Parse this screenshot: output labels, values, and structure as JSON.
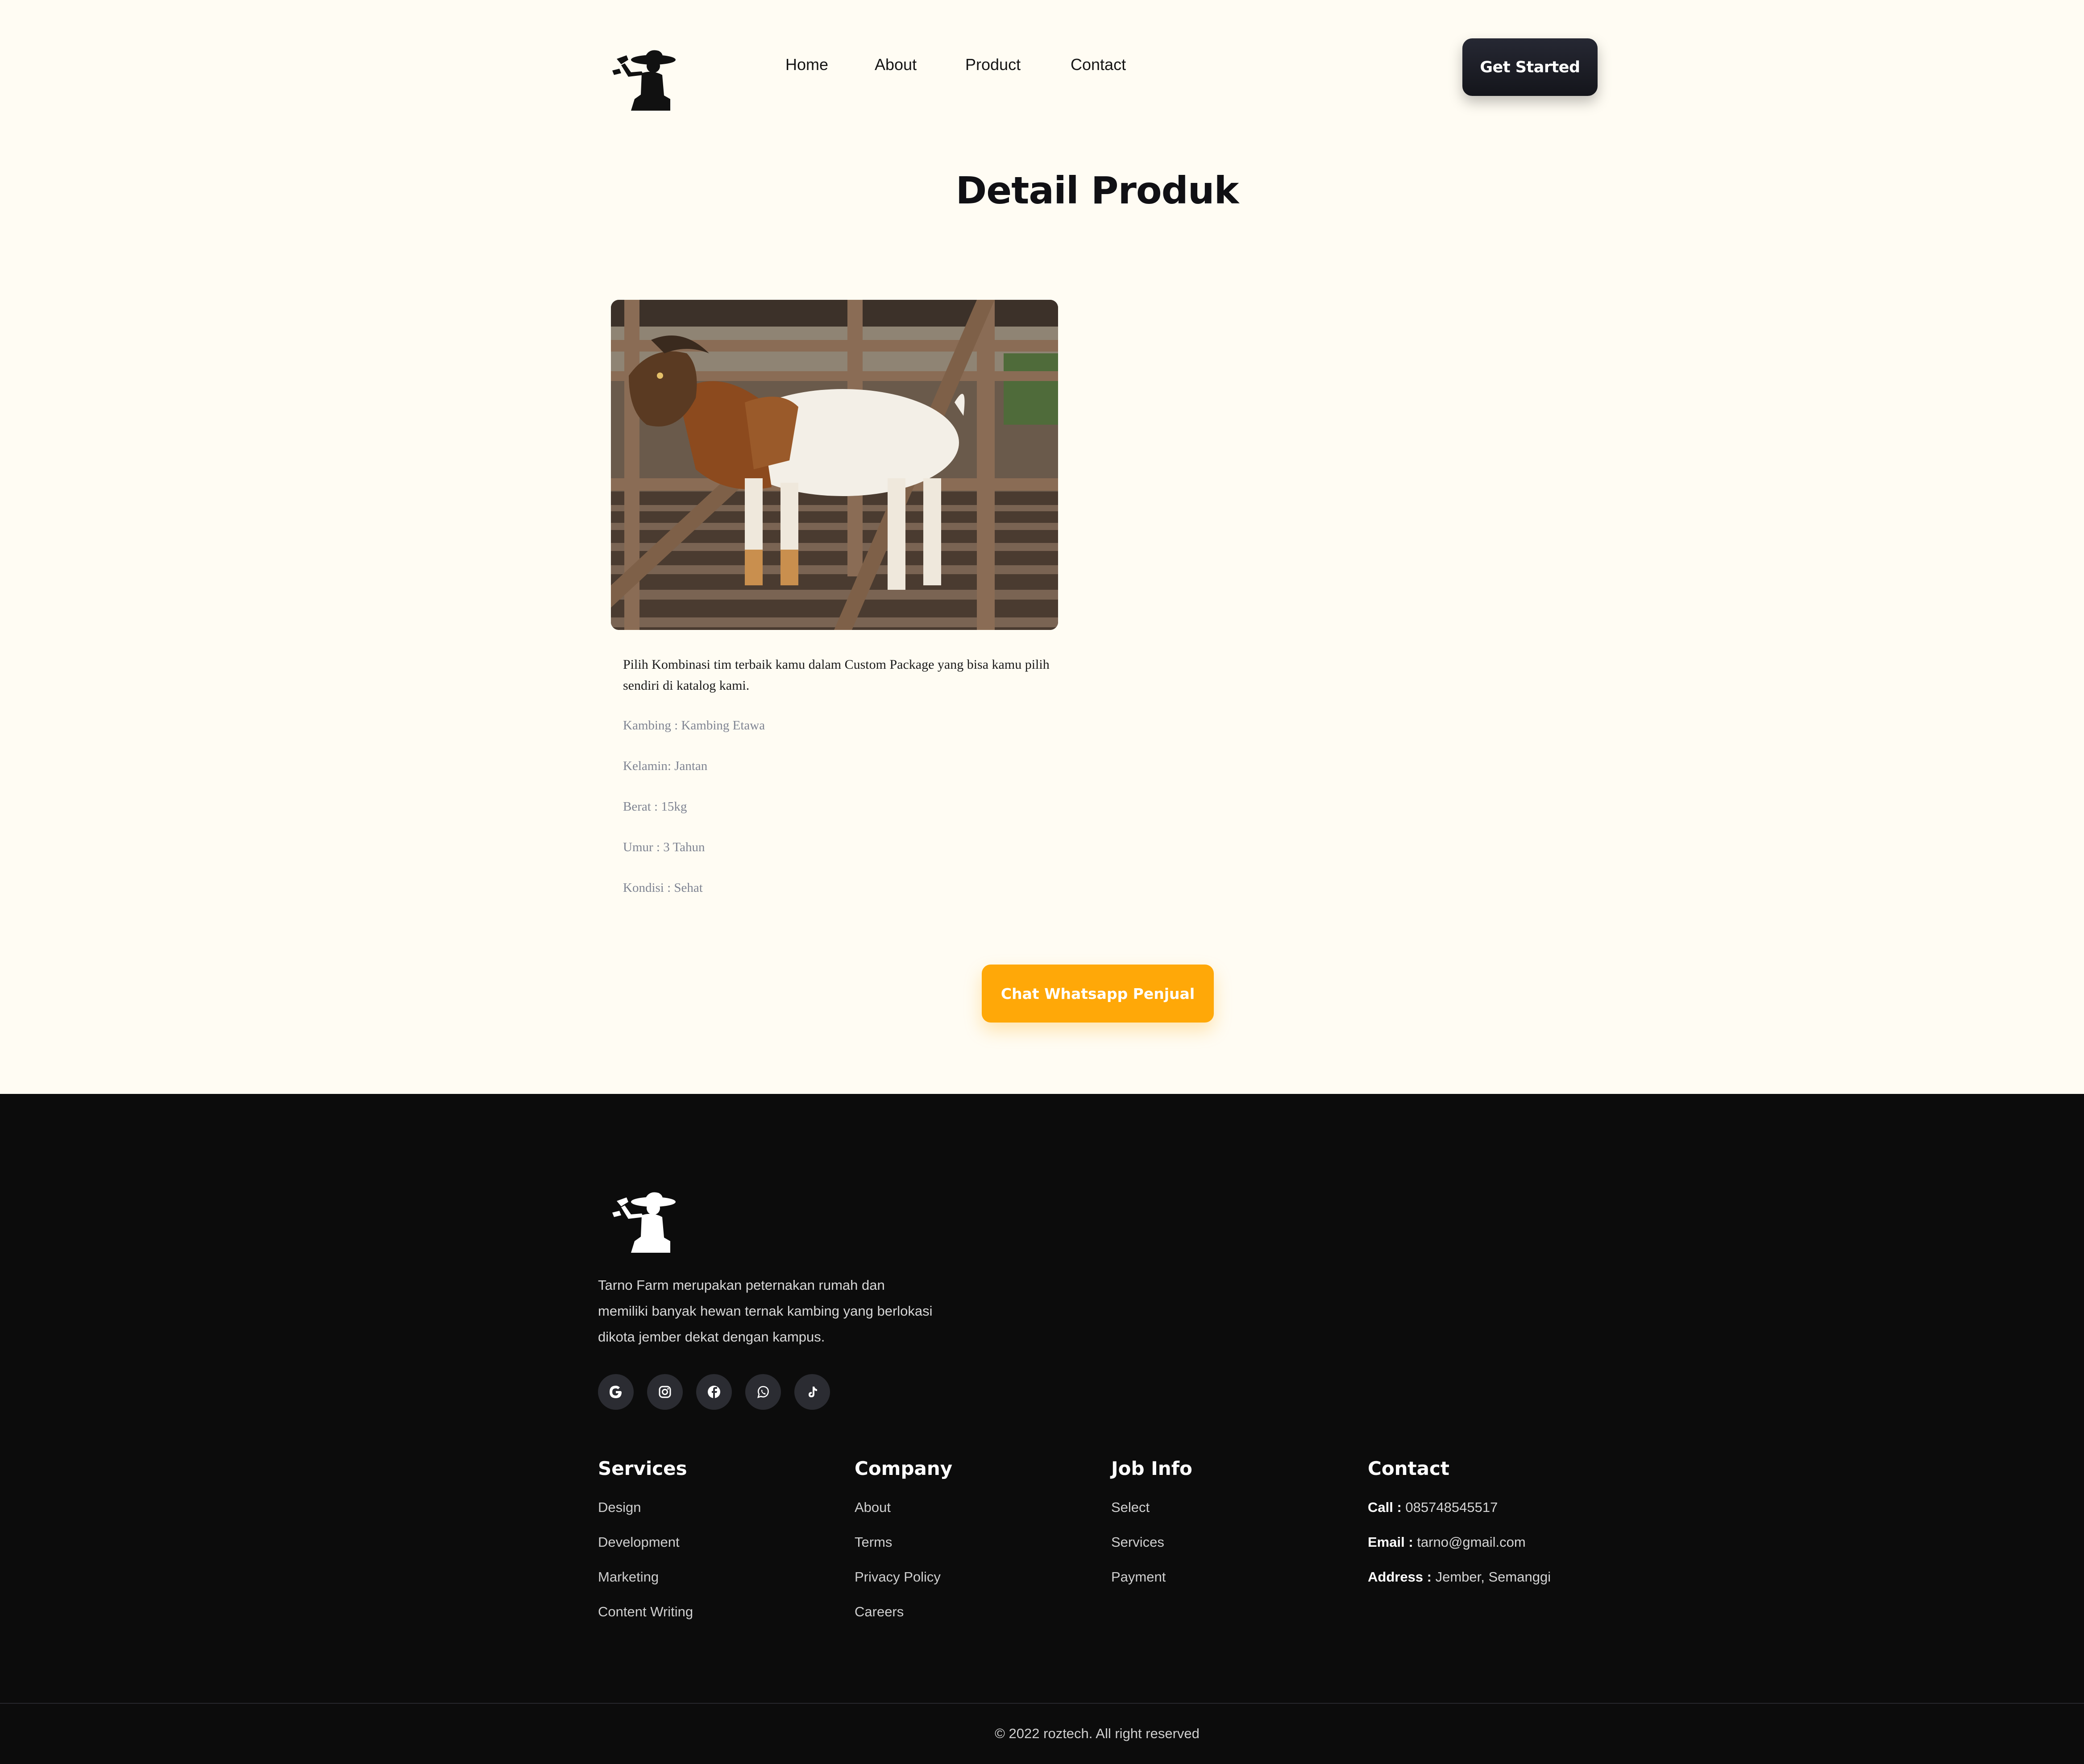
{
  "nav": {
    "links": [
      "Home",
      "About",
      "Product",
      "Contact"
    ],
    "cta_label": "Get Started"
  },
  "main": {
    "title": "Detail Produk",
    "description": "Pilih Kombinasi tim terbaik kamu dalam Custom Package yang bisa kamu pilih sendiri di katalog kami.",
    "specs": [
      "Kambing : Kambing Etawa",
      "Kelamin: Jantan",
      "Berat : 15kg",
      "Umur : 3 Tahun",
      "Kondisi : Sehat"
    ],
    "chat_button": "Chat Whatsapp Penjual"
  },
  "footer": {
    "about": "Tarno Farm merupakan peternakan rumah dan memiliki banyak hewan ternak kambing yang berlokasi dikota jember dekat dengan kampus.",
    "social_icons": [
      "google-icon",
      "instagram-icon",
      "facebook-icon",
      "whatsapp-icon",
      "tiktok-icon"
    ],
    "columns": {
      "services": {
        "title": "Services",
        "links": [
          "Design",
          "Development",
          "Marketing",
          "Content Writing"
        ]
      },
      "company": {
        "title": "Company",
        "links": [
          "About",
          "Terms",
          "Privacy Policy",
          "Careers"
        ]
      },
      "job_info": {
        "title": "Job Info",
        "links": [
          "Select",
          "Services",
          "Payment"
        ]
      },
      "contact": {
        "title": "Contact",
        "call_label": "Call :",
        "call_value": "085748545517",
        "email_label": "Email :",
        "email_value": "tarno@gmail.com",
        "address_label": "Address :",
        "address_value": "Jember, Semanggi"
      }
    },
    "copyright": "© 2022 roztech. All right reserved"
  },
  "colors": {
    "background": "#fffcf3",
    "accent": "#ffa808",
    "dark": "#0c0c0c"
  }
}
